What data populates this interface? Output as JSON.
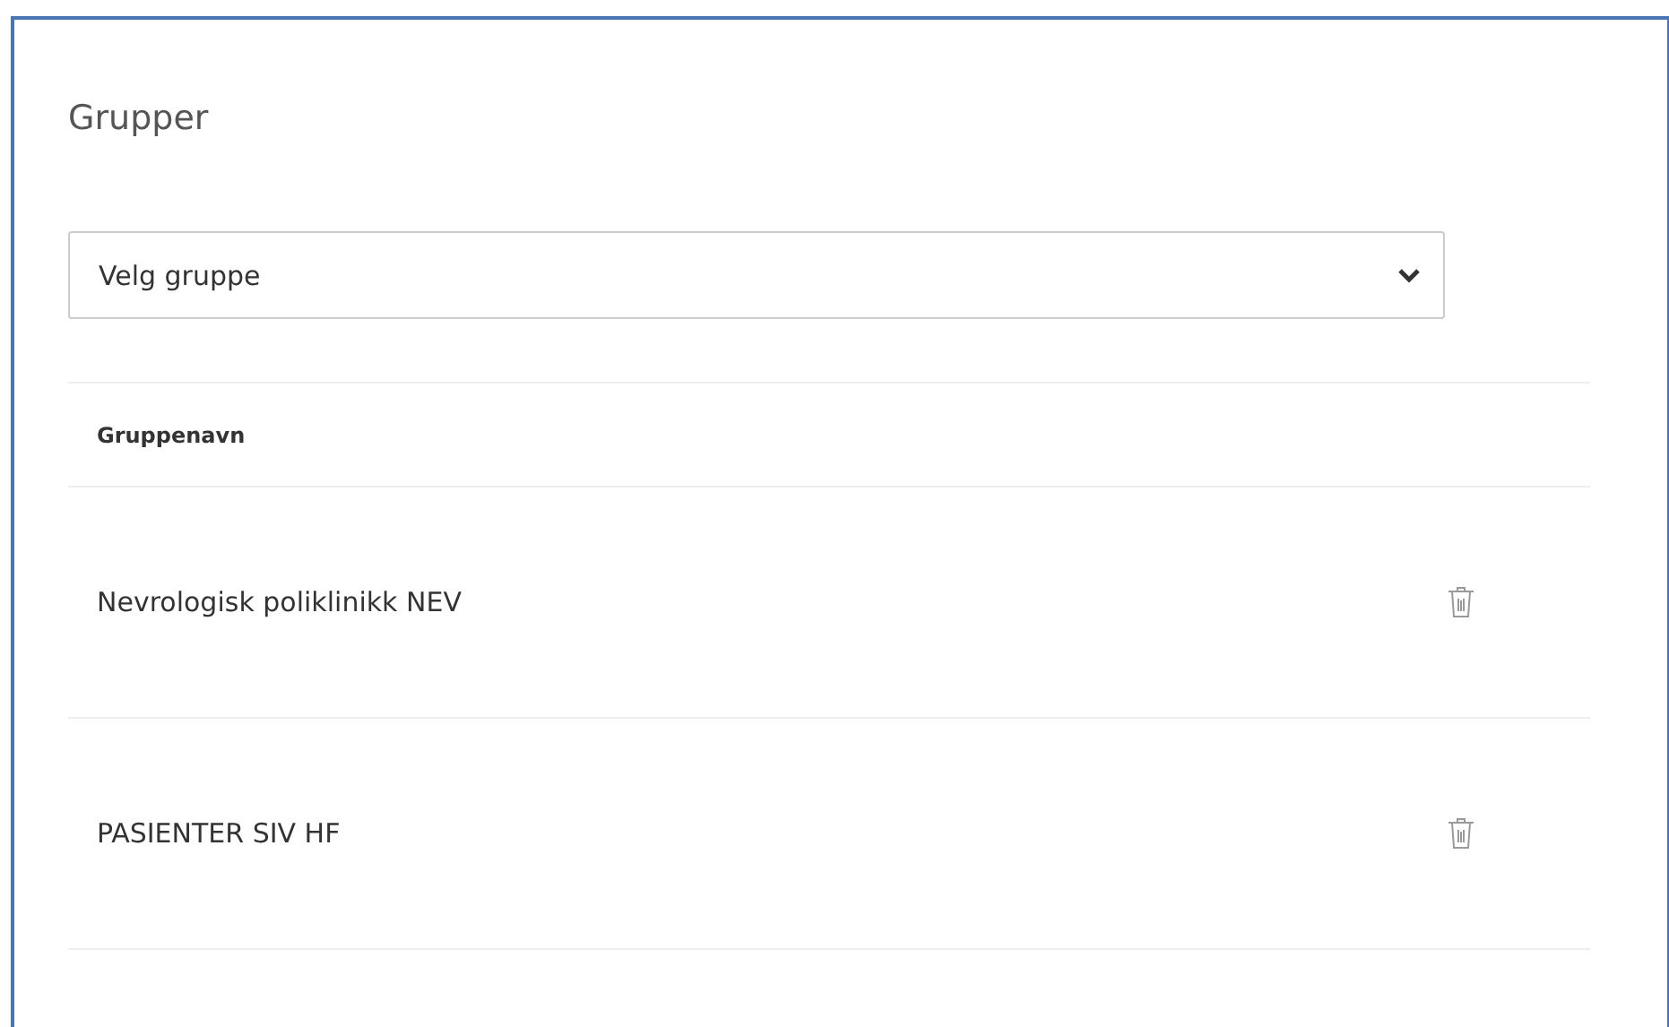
{
  "title": "Grupper",
  "group_select": {
    "placeholder": "Velg gruppe"
  },
  "table": {
    "columns": [
      "Gruppenavn"
    ],
    "rows": [
      {
        "name": "Nevrologisk poliklinikk NEV"
      },
      {
        "name": "PASIENTER SIV HF"
      }
    ]
  }
}
